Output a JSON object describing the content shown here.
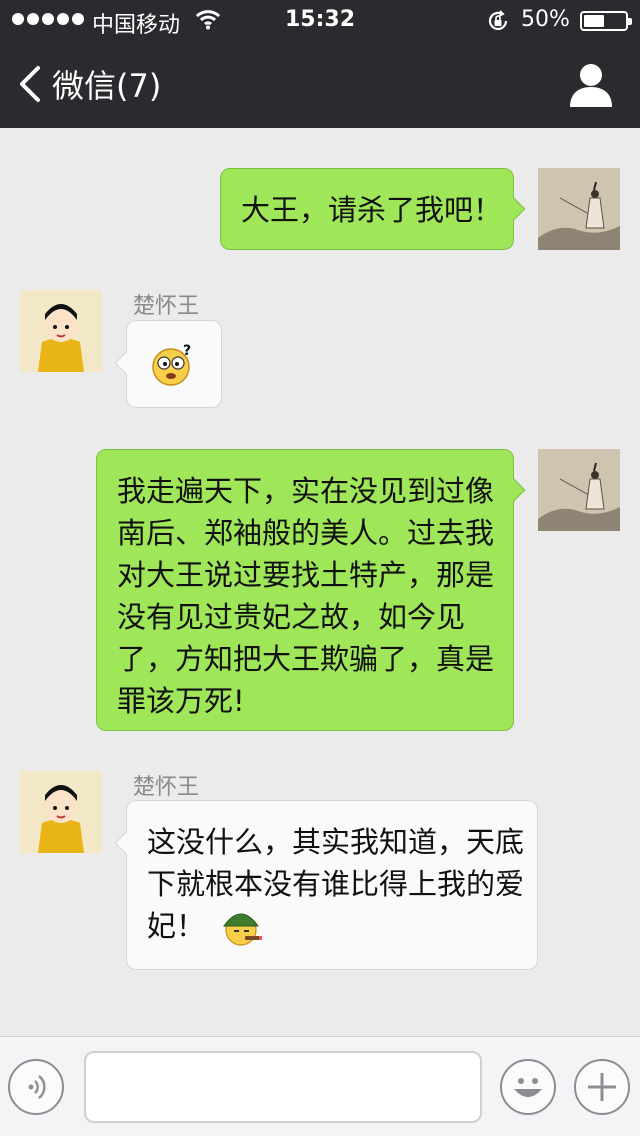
{
  "status_bar": {
    "carrier": "中国移动",
    "time": "15:32",
    "battery_text": "50%",
    "battery_level": 0.5
  },
  "nav": {
    "back_label": "微信(7)"
  },
  "messages": [
    {
      "from": "me",
      "text": "大王，请杀了我吧！"
    },
    {
      "from": "other",
      "sender": "楚怀王",
      "emoji": "confused-face-emoji"
    },
    {
      "from": "me",
      "lines": [
        "我走遍天下，实在没见到过像",
        "南后、郑袖般的美人。过去我",
        "对大王说过要找土特产，那是",
        "没有见过贵妃之故，如今见",
        "了，方知把大王欺骗了，真是",
        "罪该万死!"
      ]
    },
    {
      "from": "other",
      "sender": "楚怀王",
      "lines": [
        "这没什么，其实我知道，天底",
        "下就根本没有谁比得上我的爱",
        "妃！"
      ],
      "emoji": "army-helmet-cigar-face-emoji"
    }
  ],
  "colors": {
    "nav_bg": "#2b2b2f",
    "chat_bg": "#ebebeb",
    "my_bubble": "#9fe658",
    "their_bubble": "#fafafa"
  },
  "input_bar": {
    "voice_icon": "voice-icon",
    "emoji_icon": "smiley-icon",
    "plus_icon": "plus-icon"
  }
}
